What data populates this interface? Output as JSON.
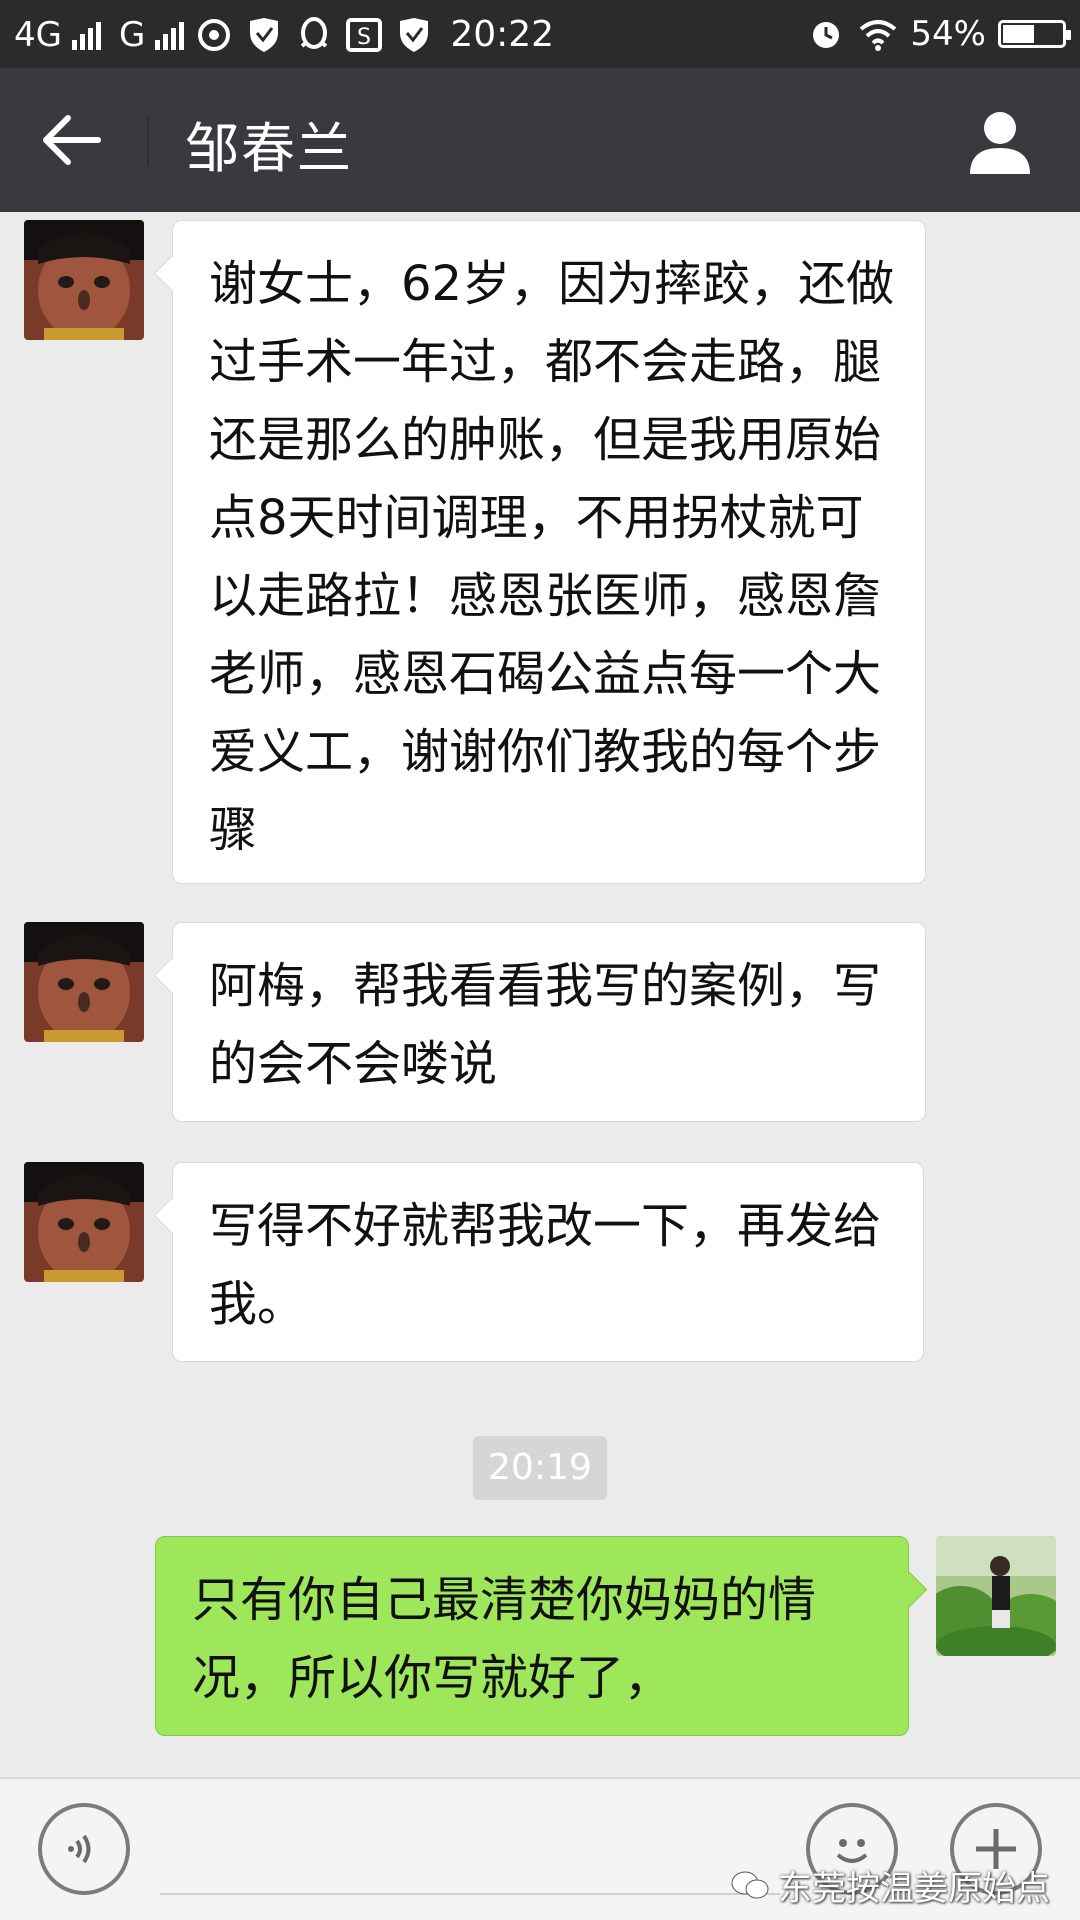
{
  "status_bar": {
    "network_1": "4G",
    "network_2": "G",
    "time": "20:22",
    "battery": "54%",
    "battery_level": 0.54
  },
  "header": {
    "title": "邹春兰"
  },
  "messages": [
    {
      "sender": "other",
      "text": "谢女士，62岁，因为摔跤，还做过手术一年过，都不会走路，腿还是那么的肿账，但是我用原始点8天时间调理，不用拐杖就可以走路拉！感恩张医师，感恩詹老师，感恩石碣公益点每一个大爱义工，谢谢你们教我的每个步骤"
    },
    {
      "sender": "other",
      "text": "阿梅，帮我看看我写的案例，写的会不会喽说"
    },
    {
      "sender": "other",
      "text": "写得不好就帮我改一下，再发给我。"
    },
    {
      "sender": "me",
      "text": "只有你自己最清楚你妈妈的情况，所以你写就好了，"
    }
  ],
  "timestamp": "20:19",
  "watermark": "东莞按温姜原始点",
  "colors": {
    "status_bar_bg": "#2b2b2b",
    "title_bar_bg": "#393a3f",
    "chat_bg": "#ebebeb",
    "my_bubble": "#9ee65a",
    "other_bubble": "#ffffff"
  }
}
